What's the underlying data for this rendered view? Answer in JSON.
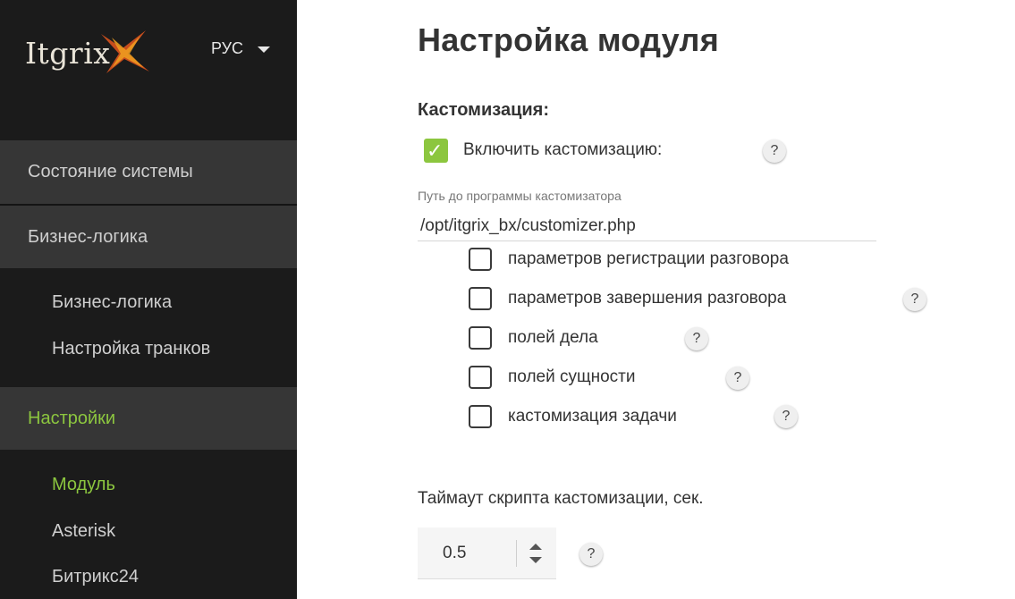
{
  "sidebar": {
    "logo_text": "Itgrix",
    "language": "РУС",
    "groups": [
      {
        "label": "Состояние системы"
      },
      {
        "label": "Бизнес-логика"
      },
      {
        "label": "Настройки"
      }
    ],
    "business_items": [
      {
        "label": "Бизнес-логика"
      },
      {
        "label": "Настройка транков"
      }
    ],
    "settings_items": [
      {
        "label": "Модуль"
      },
      {
        "label": "Asterisk"
      },
      {
        "label": "Битрикс24"
      }
    ]
  },
  "main": {
    "title": "Настройка модуля",
    "section_title": "Кастомизация:",
    "enable_label": "Включить кастомизацию:",
    "enable_checked": true,
    "path_caption": "Путь до программы кастомизатора",
    "path_value": "/opt/itgrix_bx/customizer.php",
    "options": [
      {
        "label": "параметров регистрации разговора",
        "checked": false
      },
      {
        "label": "параметров завершения разговора",
        "checked": false
      },
      {
        "label": "полей дела",
        "checked": false
      },
      {
        "label": "полей сущности",
        "checked": false
      },
      {
        "label": "кастомизация задачи",
        "checked": false
      }
    ],
    "help_glyph": "?",
    "timeout_label": "Таймаут скрипта кастомизации, сек.",
    "timeout_value": "0.5"
  },
  "colors": {
    "sidebar_bg": "#1b1b1b",
    "group_bg": "#363636",
    "accent": "#8cc63f"
  }
}
